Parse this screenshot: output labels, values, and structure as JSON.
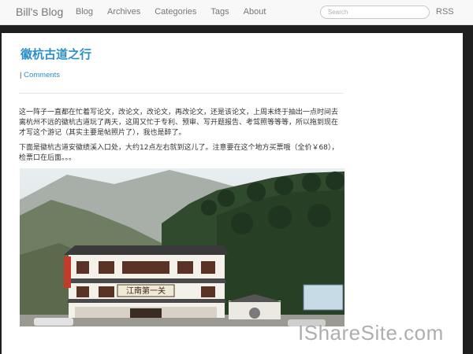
{
  "header": {
    "brand": "Bill's Blog",
    "nav": [
      "Blog",
      "Archives",
      "Categories",
      "Tags",
      "About"
    ],
    "search_placeholder": "Search",
    "rss": "RSS"
  },
  "post": {
    "title": "徽杭古道之行",
    "meta_separator": "|",
    "comments_link": "Comments",
    "paragraph1": "这一阵子一直都在忙着写论文，改论文，改论文，再改论文，还是该论文，上周末终于抽出一点时间去离杭州不远的徽杭古道玩了两天，这周又忙于专利、预审、写开题报告、考驾照等等等，所以拖到现在才写这个游记（其实主要是帖照片了），我也是醉了。",
    "paragraph2": "下面是徽杭古道安徽绩溪入口处，大约12点左右就到这儿了。注意要在这个地方买票哦（全价￥68），检票口在后面。。。",
    "photo_sign_text": "江南第一关"
  },
  "watermark": "IShareSite.com",
  "colors": {
    "link_blue": "#2a8fc7",
    "navbar_bg": "#f8f8f8",
    "page_bg": "#1f1f1f"
  }
}
